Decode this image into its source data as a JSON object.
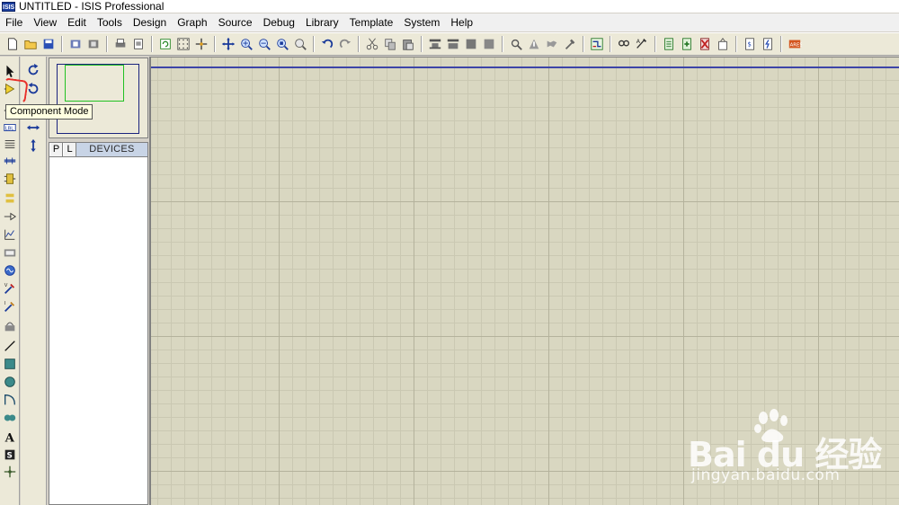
{
  "window": {
    "app_icon_text": "ISIS",
    "title": "UNTITLED - ISIS Professional"
  },
  "menu": [
    "File",
    "Edit",
    "View",
    "Tools",
    "Design",
    "Graph",
    "Source",
    "Debug",
    "Library",
    "Template",
    "System",
    "Help"
  ],
  "toolbar": {
    "groups": [
      [
        "new-file-icon",
        "open-file-icon",
        "save-icon"
      ],
      [
        "import-icon",
        "export-icon"
      ],
      [
        "print-icon",
        "print-area-icon"
      ],
      [
        "refresh-icon",
        "grid-icon",
        "origin-icon"
      ],
      [
        "pan-icon",
        "zoom-in-icon",
        "zoom-out-icon",
        "zoom-all-icon",
        "zoom-area-icon"
      ],
      [
        "undo-icon",
        "redo-icon"
      ],
      [
        "cut-icon",
        "copy-icon",
        "paste-icon"
      ],
      [
        "block-copy-icon",
        "block-move-icon",
        "block-rotate-icon",
        "block-delete-icon"
      ],
      [
        "pick-device-icon",
        "make-device-icon",
        "packaging-tool-icon",
        "decompose-icon"
      ],
      [
        "wire-autorouter-icon"
      ],
      [
        "search-tag-icon",
        "property-assignment-icon"
      ],
      [
        "new-sheet-icon",
        "add-sheet-icon",
        "remove-sheet-icon",
        "goto-sheet-icon"
      ],
      [
        "bill-of-materials-icon",
        "electrical-rule-check-icon"
      ],
      [
        "ares-netlist-icon"
      ]
    ]
  },
  "left_tools": {
    "items": [
      "selection-mode-icon",
      "component-mode-icon",
      "junction-dot-icon",
      "wire-label-icon",
      "text-script-icon",
      "buses-icon",
      "subcircuit-icon",
      "terminals-icon",
      "device-pins-icon",
      "graph-icon",
      "tape-recorder-icon",
      "generator-icon",
      "voltage-probe-icon",
      "current-probe-icon",
      "virtual-instrument-icon",
      "line-icon",
      "box-icon",
      "circle-icon",
      "arc-icon",
      "path-icon",
      "text-icon",
      "symbol-icon",
      "marker-icon"
    ]
  },
  "rotation_tools": [
    "rotate-clockwise-icon",
    "rotate-anticlockwise-icon",
    "mirror-horizontal-icon",
    "mirror-vertical-icon"
  ],
  "devices_panel": {
    "pick_label": "P",
    "library_label": "L",
    "title": "DEVICES"
  },
  "tooltip": {
    "text": "Component Mode"
  },
  "colors": {
    "canvas": "#d9d7c1",
    "grid_major": "#b4b29c",
    "grid_minor": "#cac8b2",
    "sheet_border": "#3d45a8",
    "overview_view": "#22c122",
    "highlight": "#e8302a",
    "tooltip_bg": "#ffffe1"
  },
  "watermark": {
    "brand": "Bai du 经验",
    "url": "jingyan.baidu.com"
  }
}
